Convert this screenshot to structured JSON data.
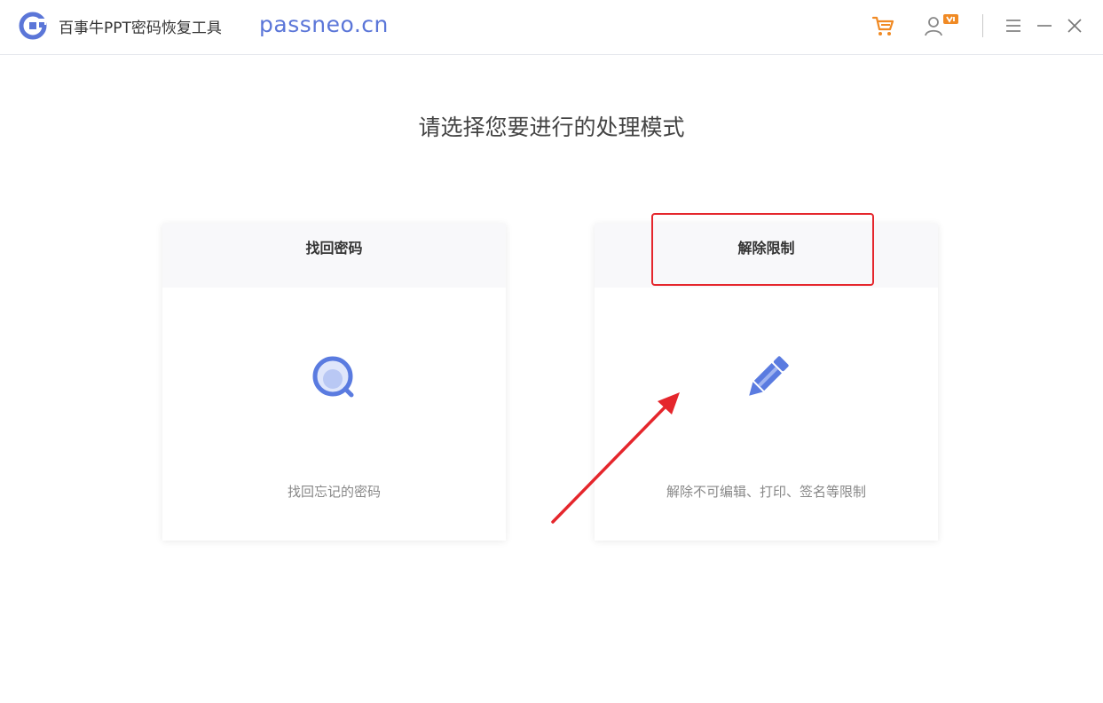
{
  "app": {
    "title": "百事牛PPT密码恢复工具",
    "site": "passneo.cn",
    "icons": [
      "logo-icon",
      "cart-icon",
      "user-vip-icon",
      "menu-icon",
      "minimize-icon",
      "close-icon"
    ]
  },
  "main": {
    "heading": "请选择您要进行的处理模式",
    "cards": [
      {
        "title": "找回密码",
        "icon": "magnifier-icon",
        "description": "找回忘记的密码"
      },
      {
        "title": "解除限制",
        "icon": "pencil-icon",
        "description": "解除不可编辑、打印、签名等限制"
      }
    ]
  },
  "colors": {
    "accent": "#5b76d8",
    "icon_blue": "#5a7be0",
    "cart_orange": "#f08a24",
    "annotation_red": "#e5262c"
  }
}
